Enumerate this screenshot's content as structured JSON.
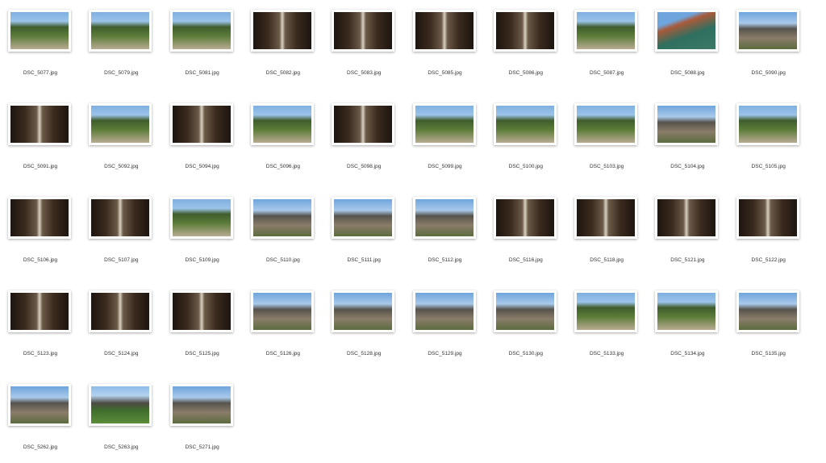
{
  "files": [
    {
      "name": "DSC_5077.jpg",
      "scene": "garden"
    },
    {
      "name": "DSC_5079.jpg",
      "scene": "garden"
    },
    {
      "name": "DSC_5081.jpg",
      "scene": "garden"
    },
    {
      "name": "DSC_5082.jpg",
      "scene": "interior"
    },
    {
      "name": "DSC_5083.jpg",
      "scene": "interior"
    },
    {
      "name": "DSC_5085.jpg",
      "scene": "interior"
    },
    {
      "name": "DSC_5086.jpg",
      "scene": "interior"
    },
    {
      "name": "DSC_5087.jpg",
      "scene": "garden"
    },
    {
      "name": "DSC_5088.jpg",
      "scene": "roof"
    },
    {
      "name": "DSC_5090.jpg",
      "scene": "building"
    },
    {
      "name": "DSC_5091.jpg",
      "scene": "interior"
    },
    {
      "name": "DSC_5092.jpg",
      "scene": "garden"
    },
    {
      "name": "DSC_5094.jpg",
      "scene": "interior"
    },
    {
      "name": "DSC_5096.jpg",
      "scene": "garden"
    },
    {
      "name": "DSC_5098.jpg",
      "scene": "interior"
    },
    {
      "name": "DSC_5099.jpg",
      "scene": "garden"
    },
    {
      "name": "DSC_5100.jpg",
      "scene": "garden"
    },
    {
      "name": "DSC_5103.jpg",
      "scene": "garden"
    },
    {
      "name": "DSC_5104.jpg",
      "scene": "building"
    },
    {
      "name": "DSC_5105.jpg",
      "scene": "garden"
    },
    {
      "name": "DSC_5106.jpg",
      "scene": "interior"
    },
    {
      "name": "DSC_5107.jpg",
      "scene": "interior"
    },
    {
      "name": "DSC_5109.jpg",
      "scene": "garden"
    },
    {
      "name": "DSC_5110.jpg",
      "scene": "building"
    },
    {
      "name": "DSC_5111.jpg",
      "scene": "building"
    },
    {
      "name": "DSC_5112.jpg",
      "scene": "building"
    },
    {
      "name": "DSC_5116.jpg",
      "scene": "interior"
    },
    {
      "name": "DSC_5118.jpg",
      "scene": "interior"
    },
    {
      "name": "DSC_5121.jpg",
      "scene": "interior"
    },
    {
      "name": "DSC_5122.jpg",
      "scene": "interior"
    },
    {
      "name": "DSC_5123.jpg",
      "scene": "interior"
    },
    {
      "name": "DSC_5124.jpg",
      "scene": "interior"
    },
    {
      "name": "DSC_5125.jpg",
      "scene": "interior"
    },
    {
      "name": "DSC_5126.jpg",
      "scene": "building"
    },
    {
      "name": "DSC_5128.jpg",
      "scene": "building"
    },
    {
      "name": "DSC_5129.jpg",
      "scene": "building"
    },
    {
      "name": "DSC_5130.jpg",
      "scene": "building"
    },
    {
      "name": "DSC_5133.jpg",
      "scene": "garden"
    },
    {
      "name": "DSC_5134.jpg",
      "scene": "garden"
    },
    {
      "name": "DSC_5135.jpg",
      "scene": "building"
    },
    {
      "name": "DSC_5262.jpg",
      "scene": "building"
    },
    {
      "name": "DSC_5263.jpg",
      "scene": "pond"
    },
    {
      "name": "DSC_5271.jpg",
      "scene": "building"
    }
  ]
}
